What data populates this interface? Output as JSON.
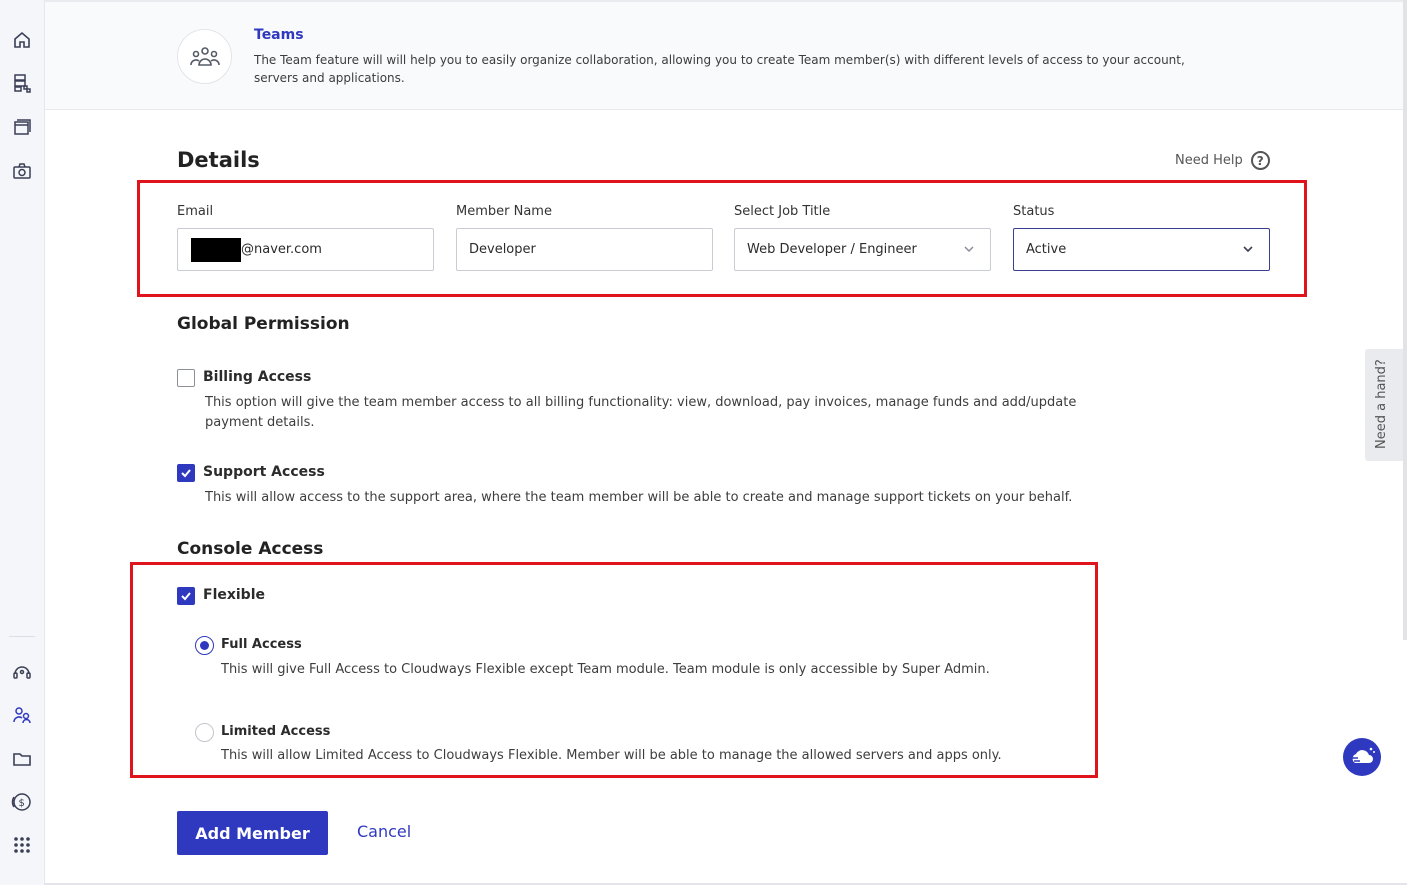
{
  "banner": {
    "title": "Teams",
    "description": "The Team feature will will help you to easily organize collaboration, allowing you to create Team member(s) with different levels of access to your account, servers and applications."
  },
  "details": {
    "heading": "Details",
    "need_help": "Need Help",
    "email_label": "Email",
    "email_value": "@naver.com",
    "member_name_label": "Member Name",
    "member_name_value": "Developer",
    "job_title_label": "Select Job Title",
    "job_title_value": "Web Developer / Engineer",
    "status_label": "Status",
    "status_value": "Active"
  },
  "global_permission": {
    "heading": "Global Permission",
    "billing_title": "Billing Access",
    "billing_checked": false,
    "billing_desc": "This option will give the team member access to all billing functionality: view, download, pay invoices, manage funds and add/update payment details.",
    "support_title": "Support Access",
    "support_checked": true,
    "support_desc": "This will allow access to the support area, where the team member will be able to create and manage support tickets on your behalf."
  },
  "console_access": {
    "heading": "Console Access",
    "flexible_title": "Flexible",
    "flexible_checked": true,
    "full_title": "Full Access",
    "full_selected": true,
    "full_desc": "This will give Full Access to Cloudways Flexible except Team module. Team module is only accessible by Super Admin.",
    "limited_title": "Limited Access",
    "limited_selected": false,
    "limited_desc": "This will allow Limited Access to Cloudways Flexible. Member will be able to manage the allowed servers and apps only."
  },
  "actions": {
    "add_member": "Add Member",
    "cancel": "Cancel"
  },
  "side_tab": "Need a hand?",
  "icons": [
    "home-icon",
    "servers-icon",
    "applications-icon",
    "addons-icon",
    "support-icon",
    "team-icon",
    "projects-icon",
    "billing-icon",
    "apps-grid-icon",
    "teams-icon",
    "chevron-down-icon",
    "help-icon",
    "checkbox-check-icon",
    "chat-bot-icon"
  ],
  "colors": {
    "accent": "#2f39bf",
    "highlight_box": "#e0141c"
  }
}
